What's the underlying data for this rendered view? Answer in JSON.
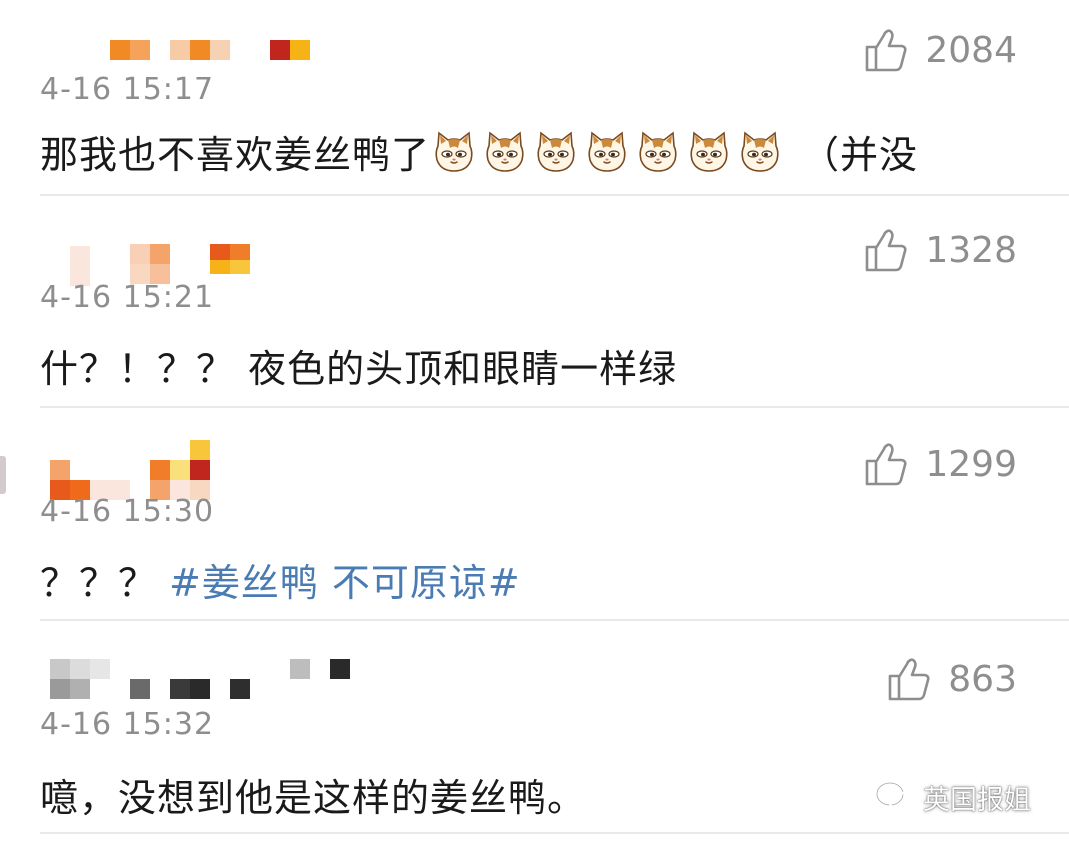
{
  "comments": [
    {
      "time": "4-16 15:17",
      "likes": "2084",
      "text": "那我也不喜欢姜丝鸭了",
      "emoji_icon": "cat-face-icon",
      "emoji_count": 7,
      "text_after": "（并没"
    },
    {
      "time": "4-16 15:21",
      "likes": "1328",
      "text": "什？！？？ 夜色的头顶和眼睛一样绿"
    },
    {
      "time": "4-16 15:30",
      "likes": "1299",
      "text": "？？？",
      "hashtag": "#姜丝鸭 不可原谅#"
    },
    {
      "time": "4-16 15:32",
      "likes": "863",
      "text": "噫，没想到他是这样的姜丝鸭。"
    }
  ],
  "watermark": {
    "label": "英国报姐",
    "icon": "wechat-icon"
  },
  "colors": {
    "hashtag": "#4a7bb3",
    "meta": "#8e8e8e",
    "text": "#1a1a1a",
    "divider": "#e9e9e9"
  }
}
